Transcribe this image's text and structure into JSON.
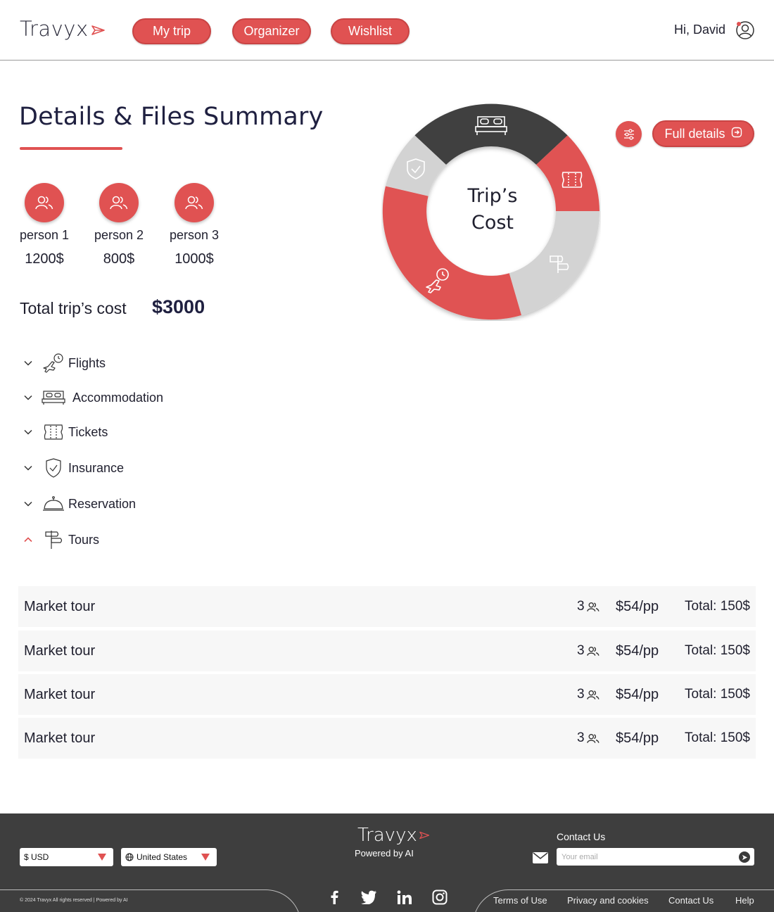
{
  "header": {
    "logo": "Travyx",
    "nav": [
      "My trip",
      "Organizer",
      "Wishlist"
    ],
    "greeting": "Hi, David"
  },
  "summary": {
    "title": "Details & Files Summary",
    "persons": [
      {
        "name": "person 1",
        "cost": "1200$"
      },
      {
        "name": "person 2",
        "cost": "800$"
      },
      {
        "name": "person 3",
        "cost": "1000$"
      }
    ],
    "total_label": "Total trip’s cost",
    "total_value": "$3000"
  },
  "categories": [
    {
      "label": "Flights",
      "icon": "airplane-icon",
      "expanded": false
    },
    {
      "label": "Accommodation",
      "icon": "bed-icon",
      "expanded": false
    },
    {
      "label": "Tickets",
      "icon": "ticket-icon",
      "expanded": false
    },
    {
      "label": "Insurance",
      "icon": "shield-icon",
      "expanded": false
    },
    {
      "label": "Reservation",
      "icon": "cloche-icon",
      "expanded": false
    },
    {
      "label": "Tours",
      "icon": "signpost-icon",
      "expanded": true
    }
  ],
  "donut": {
    "center_line1": "Trip’s",
    "center_line2": "Cost",
    "colors": {
      "red": "#e05252",
      "dark": "#3f3f3f",
      "light": "#d3d3d3"
    }
  },
  "actions": {
    "full_details": "Full details"
  },
  "tours": [
    {
      "name": "Market tour",
      "count": "3",
      "price": "$54/pp",
      "total": "Total: 150$"
    },
    {
      "name": "Market tour",
      "count": "3",
      "price": "$54/pp",
      "total": "Total: 150$"
    },
    {
      "name": "Market tour",
      "count": "3",
      "price": "$54/pp",
      "total": "Total: 150$"
    },
    {
      "name": "Market tour",
      "count": "3",
      "price": "$54/pp",
      "total": "Total: 150$"
    }
  ],
  "footer": {
    "currency": "$ USD",
    "country": "United States",
    "logo": "Travyx",
    "powered": "Powered by AI",
    "contact_title": "Contact Us",
    "email_placeholder": "Your email",
    "copyright": "© 2024 Travyx  All rights reserved | Powered by AI",
    "links": [
      "Terms of Use",
      "Privacy and cookies",
      "Contact Us",
      "Help"
    ]
  },
  "theme": {
    "accent": "#e05252",
    "footer_bg": "#3e3e3e"
  }
}
